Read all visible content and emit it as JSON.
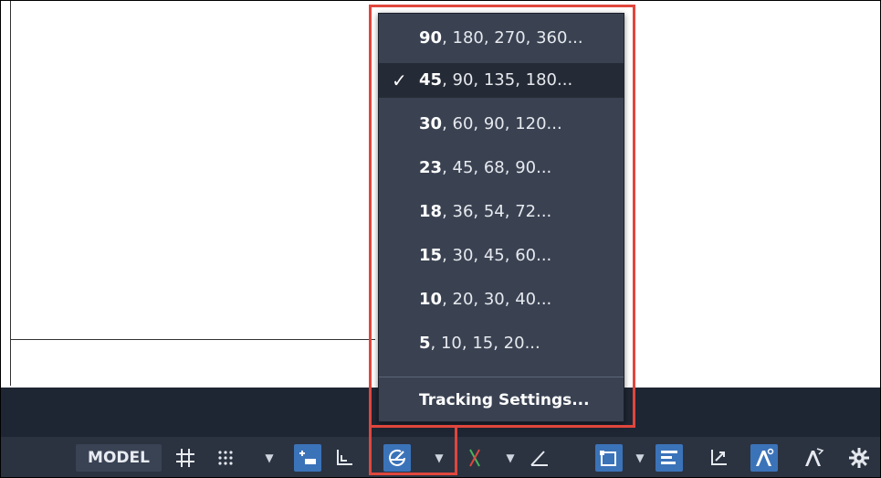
{
  "polar_menu": {
    "items": [
      {
        "bold": "90",
        "rest": ", 180, 270, 360...",
        "checked": false
      },
      {
        "bold": "45",
        "rest": ", 90, 135, 180...",
        "checked": true
      },
      {
        "bold": "30",
        "rest": ", 60, 90, 120...",
        "checked": false
      },
      {
        "bold": "23",
        "rest": ", 45, 68, 90...",
        "checked": false
      },
      {
        "bold": "18",
        "rest": ", 36, 54, 72...",
        "checked": false
      },
      {
        "bold": "15",
        "rest": ", 30, 45, 60...",
        "checked": false
      },
      {
        "bold": "10",
        "rest": ", 20, 30, 40...",
        "checked": false
      },
      {
        "bold": "5",
        "rest": ", 10, 15, 20...",
        "checked": false
      }
    ],
    "check_glyph": "✓",
    "tracking_settings": "Tracking Settings..."
  },
  "statusbar": {
    "model_label": "MODEL",
    "icons": [
      "grid-icon",
      "snap-icon",
      "infer-constraints-icon",
      "ortho-icon",
      "polar-tracking-icon",
      "isodraft-icon",
      "object-snap-tracking-icon",
      "object-snap-icon",
      "lineweight-icon",
      "ucs-icon",
      "annotation-visibility-icon",
      "auto-scale-icon",
      "settings-icon"
    ]
  },
  "colors": {
    "highlight": "#e0463d",
    "active_blue": "#3b73b9",
    "menu_bg": "#3a4252"
  }
}
